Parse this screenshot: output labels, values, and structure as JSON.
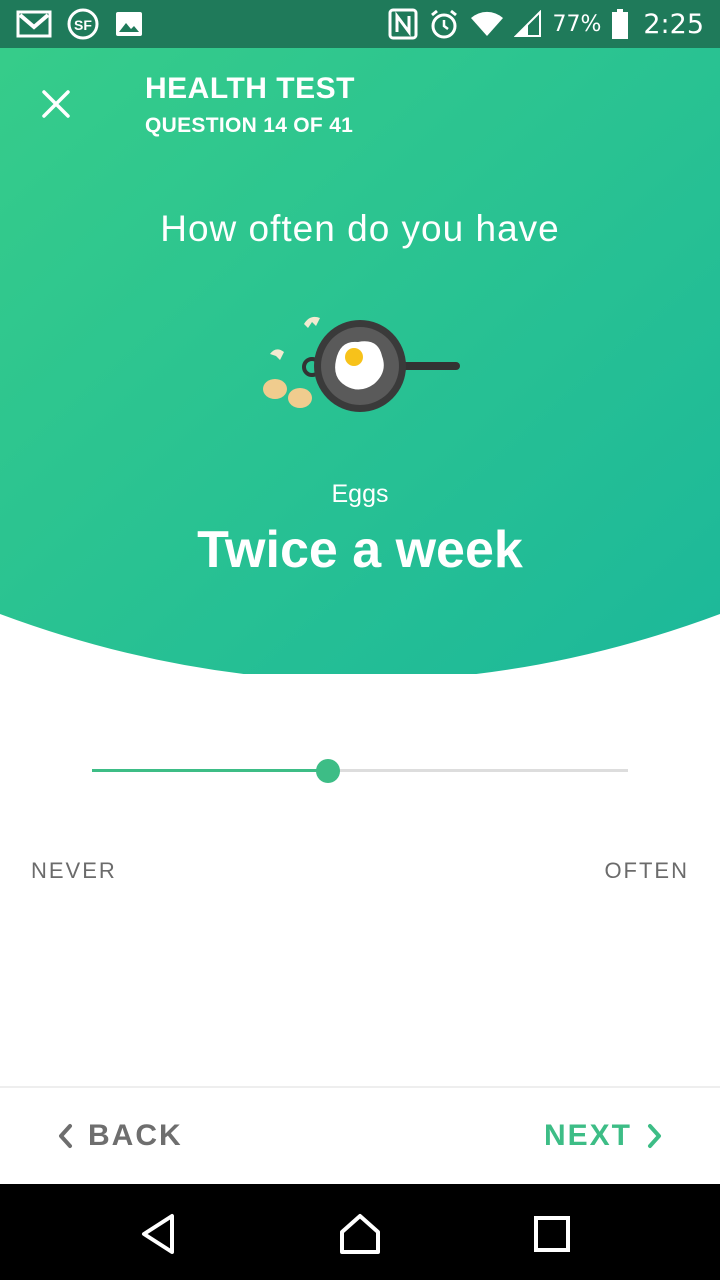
{
  "status_bar": {
    "left_icons": [
      "gmail-icon",
      "sf-app-icon",
      "gallery-icon"
    ],
    "right_icons": [
      "nfc-icon",
      "alarm-icon",
      "wifi-icon",
      "signal-icon",
      "battery-icon"
    ],
    "battery": "77%",
    "time": "2:25"
  },
  "header": {
    "title": "HEALTH TEST",
    "subtitle": "QUESTION 14 OF 41",
    "close_icon": "close-icon"
  },
  "question": {
    "text": "How often do you have",
    "illustration": "fried-egg-pan-icon",
    "food": "Eggs",
    "answer": "Twice a week"
  },
  "slider": {
    "value": 0.44,
    "min_label": "NEVER",
    "max_label": "OFTEN"
  },
  "footer": {
    "back_label": "BACK",
    "next_label": "NEXT"
  },
  "colors": {
    "accent": "#3dbd86",
    "gradient_start": "#36cc8a",
    "gradient_end": "#1cb89a"
  },
  "system_nav": [
    "back-triangle-icon",
    "home-icon",
    "recents-square-icon"
  ]
}
